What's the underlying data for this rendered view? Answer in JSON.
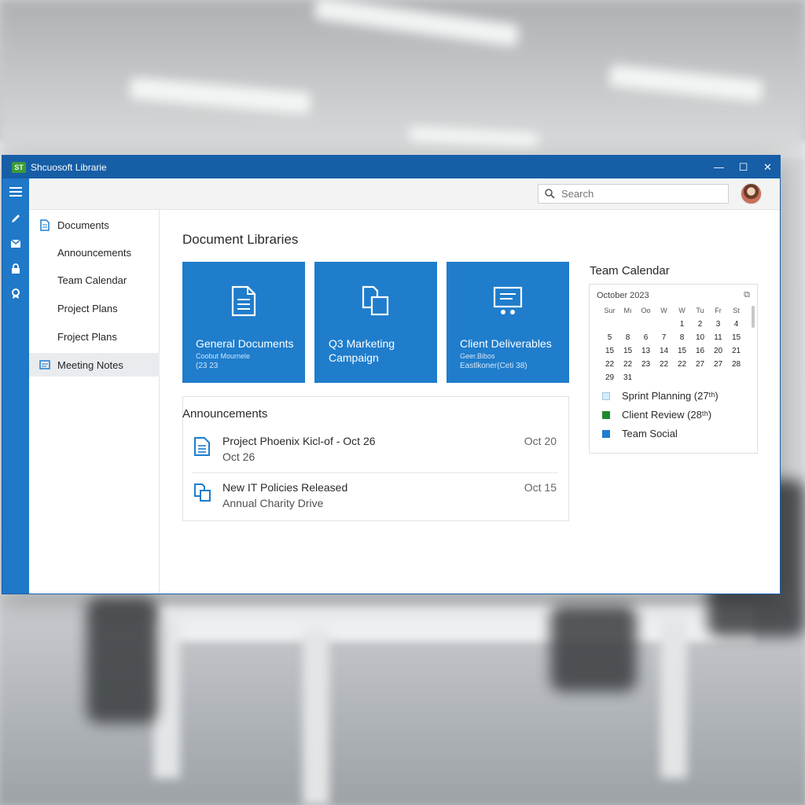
{
  "window": {
    "badge": "ST",
    "title": "Shcuosoft Librarie",
    "controls": {
      "minimize": "—",
      "maximize": "☐",
      "close": "✕"
    }
  },
  "search": {
    "placeholder": "Search"
  },
  "sidebar": {
    "items": [
      {
        "label": "Documents",
        "icon": "document-icon"
      },
      {
        "label": "Announcements"
      },
      {
        "label": "Team Calendar"
      },
      {
        "label": "Project Plans"
      },
      {
        "label": "Froject Plans"
      },
      {
        "label": "Meeting Notes",
        "icon": "notes-icon",
        "active": true
      }
    ]
  },
  "main": {
    "title": "Document Libraries",
    "tiles": [
      {
        "name": "General Documents",
        "sub1": "Coobut Mournele",
        "sub2": "(23 23",
        "icon": "document-icon"
      },
      {
        "name": "Q3 Marketing Campaign",
        "name_line1": "Q3 Marketing",
        "name_line2": "Campaign",
        "icon": "copy-icon"
      },
      {
        "name": "Client Deliverables",
        "sub1": "Geer.Bibos",
        "sub2": "Eastlkoner(Ceti 38)",
        "icon": "presentation-icon"
      }
    ]
  },
  "announcements": {
    "title": "Announcements",
    "items": [
      {
        "line1": "Project Phoenix Kicl-of - Oct 26",
        "line2": "Oct 26",
        "date": "Oct 20",
        "icon": "document-icon"
      },
      {
        "line1": "New IT Policies Released",
        "line2": "Annual Charity Drive",
        "date": "Oct 15",
        "icon": "copy-icon"
      }
    ]
  },
  "calendar": {
    "title": "Team Calendar",
    "month": "October 2023",
    "expand": "⧉",
    "days_of_week": [
      "Sur",
      "Mı",
      "Oo",
      "W",
      "W",
      "Tu",
      "Fr",
      "St"
    ],
    "weeks": [
      [
        "",
        "",
        "",
        "",
        "1",
        "2",
        "3",
        "4"
      ],
      [
        "5",
        "8",
        "6",
        "7",
        "8",
        "10",
        "11",
        "15"
      ],
      [
        "15",
        "15",
        "13",
        "14",
        "15",
        "16",
        "20",
        "21"
      ],
      [
        "22",
        "22",
        "23",
        "22",
        "22",
        "27",
        "27",
        "28"
      ],
      [
        "29",
        "31",
        "",
        "",
        "",
        "",
        "",
        ""
      ]
    ],
    "events": [
      {
        "label": "Sprint Planning (27ᵗʰ)",
        "color": "#d7ecfa"
      },
      {
        "label": "Client Review (28ᵗʰ)",
        "color": "#1f8a2b"
      },
      {
        "label": "Team Social",
        "color": "#1f7dcc"
      }
    ]
  },
  "colors": {
    "accent": "#1f7dcc",
    "titlebar": "#165ea6",
    "rail": "#1f78c8"
  }
}
